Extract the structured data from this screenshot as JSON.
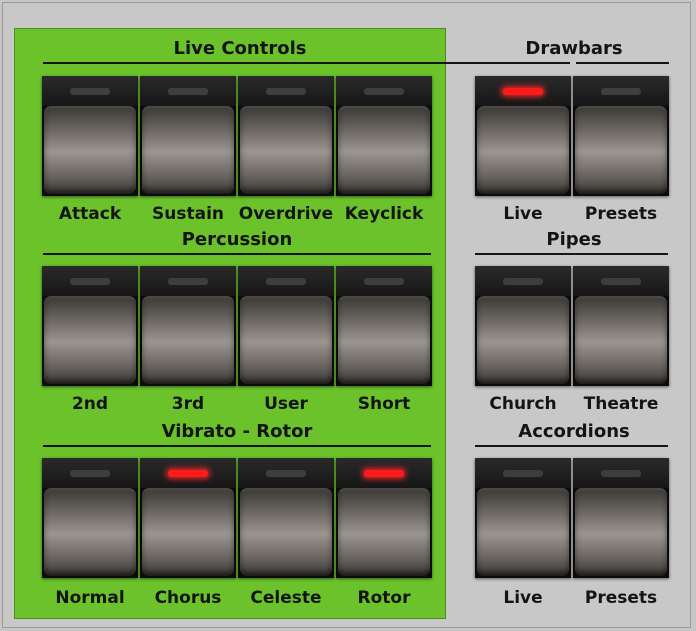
{
  "sections": {
    "live_controls": {
      "title": "Live Controls",
      "buttons": [
        {
          "label": "Attack",
          "led_on": false
        },
        {
          "label": "Sustain",
          "led_on": false
        },
        {
          "label": "Overdrive",
          "led_on": false
        },
        {
          "label": "Keyclick",
          "led_on": false
        }
      ]
    },
    "percussion": {
      "title": "Percussion",
      "buttons": [
        {
          "label": "2nd",
          "led_on": false
        },
        {
          "label": "3rd",
          "led_on": false
        },
        {
          "label": "User",
          "led_on": false
        },
        {
          "label": "Short",
          "led_on": false
        }
      ]
    },
    "vibrato_rotor": {
      "title": "Vibrato - Rotor",
      "buttons": [
        {
          "label": "Normal",
          "led_on": false
        },
        {
          "label": "Chorus",
          "led_on": true
        },
        {
          "label": "Celeste",
          "led_on": false
        },
        {
          "label": "Rotor",
          "led_on": true
        }
      ]
    },
    "drawbars": {
      "title": "Drawbars",
      "buttons": [
        {
          "label": "Live",
          "led_on": true
        },
        {
          "label": "Presets",
          "led_on": false
        }
      ]
    },
    "pipes": {
      "title": "Pipes",
      "buttons": [
        {
          "label": "Church",
          "led_on": false
        },
        {
          "label": "Theatre",
          "led_on": false
        }
      ]
    },
    "accordions": {
      "title": "Accordions",
      "buttons": [
        {
          "label": "Live",
          "led_on": false
        },
        {
          "label": "Presets",
          "led_on": false
        }
      ]
    }
  },
  "colors": {
    "panel_green": "#6cc22b",
    "background_gray": "#c6c6c6",
    "led_on": "#ff1a1a",
    "led_off": "#3e3e3e"
  }
}
